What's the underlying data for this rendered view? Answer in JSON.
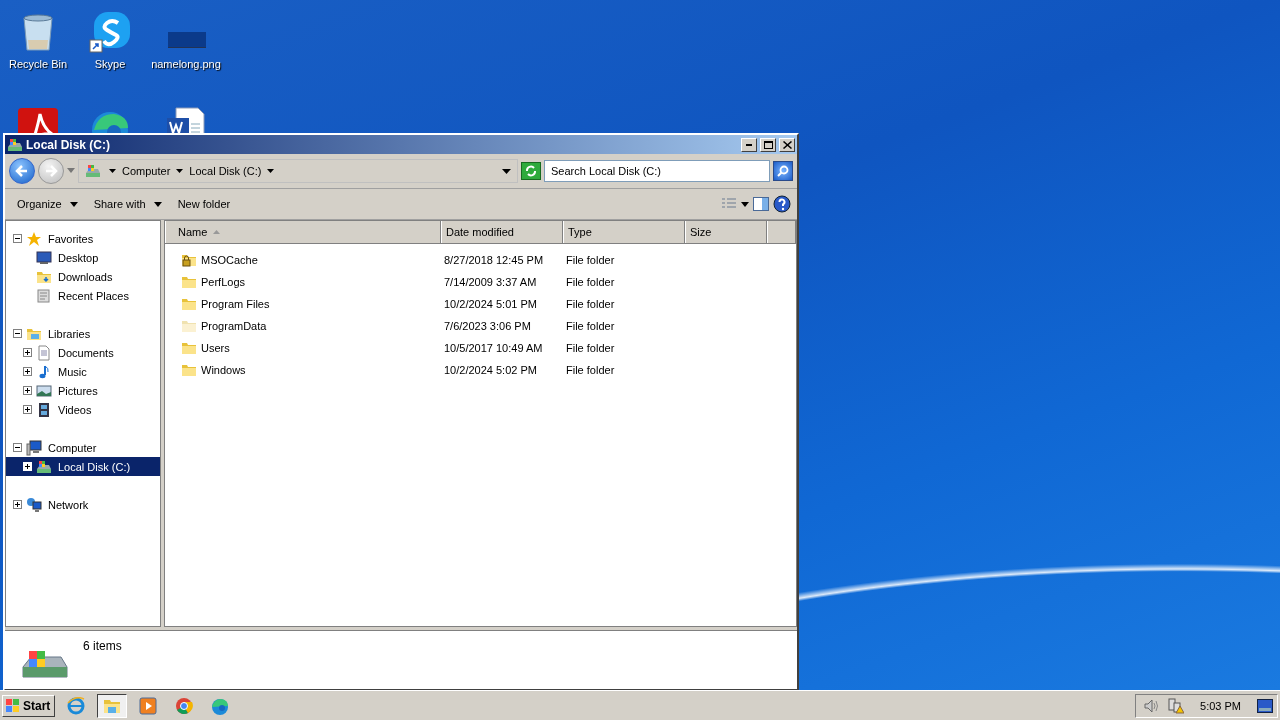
{
  "desktop": {
    "icons": [
      {
        "kind": "recycle-bin",
        "label": "Recycle Bin"
      },
      {
        "kind": "skype",
        "label": "Skype"
      },
      {
        "kind": "image",
        "label": "namelong.png"
      },
      {
        "kind": "pdf"
      },
      {
        "kind": "edge"
      },
      {
        "kind": "word"
      }
    ]
  },
  "window": {
    "title": "Local Disk (C:)",
    "address": {
      "breadcrumbs": [
        "Computer",
        "Local Disk (C:)"
      ]
    },
    "search": {
      "placeholder": "Search Local Disk (C:)"
    },
    "commands": [
      {
        "label": "Organize",
        "dropdown": true
      },
      {
        "label": "Share with",
        "dropdown": true
      },
      {
        "label": "New folder",
        "dropdown": false
      }
    ],
    "sidebar": {
      "items": [
        {
          "kind": "star",
          "label": "Favorites",
          "expanded": true,
          "selected": false,
          "children": [
            {
              "kind": "desktop",
              "label": "Desktop",
              "selected": false
            },
            {
              "kind": "downloads",
              "label": "Downloads",
              "selected": false
            },
            {
              "kind": "recent",
              "label": "Recent Places",
              "selected": false
            }
          ]
        },
        {
          "kind": "libraries",
          "label": "Libraries",
          "expanded": true,
          "selected": false,
          "children": [
            {
              "kind": "documents",
              "label": "Documents",
              "expanded": false,
              "selected": false
            },
            {
              "kind": "music",
              "label": "Music",
              "expanded": false,
              "selected": false
            },
            {
              "kind": "pictures",
              "label": "Pictures",
              "expanded": false,
              "selected": false
            },
            {
              "kind": "videos",
              "label": "Videos",
              "expanded": false,
              "selected": false
            }
          ]
        },
        {
          "kind": "computer",
          "label": "Computer",
          "expanded": true,
          "selected": false,
          "children": [
            {
              "kind": "drive",
              "label": "Local Disk (C:)",
              "expanded": false,
              "selected": true
            }
          ]
        },
        {
          "kind": "network",
          "label": "Network",
          "expanded": false,
          "selected": false
        }
      ]
    },
    "table": {
      "columns": [
        {
          "label": "Name",
          "sorted": true
        },
        {
          "label": "Date modified",
          "sorted": false
        },
        {
          "label": "Type",
          "sorted": false
        },
        {
          "label": "Size",
          "sorted": false
        }
      ],
      "rows": [
        {
          "kind": "locked",
          "name": "MSOCache",
          "date": "8/27/2018 12:45 PM",
          "type": "File folder"
        },
        {
          "kind": "folder",
          "name": "PerfLogs",
          "date": "7/14/2009 3:37 AM",
          "type": "File folder"
        },
        {
          "kind": "folder",
          "name": "Program Files",
          "date": "10/2/2024 5:01 PM",
          "type": "File folder"
        },
        {
          "kind": "hidden",
          "name": "ProgramData",
          "date": "7/6/2023 3:06 PM",
          "type": "File folder"
        },
        {
          "kind": "folder",
          "name": "Users",
          "date": "10/5/2017 10:49 AM",
          "type": "File folder"
        },
        {
          "kind": "folder",
          "name": "Windows",
          "date": "10/2/2024 5:02 PM",
          "type": "File folder"
        }
      ]
    },
    "status_bar": {
      "text": "6 items"
    }
  },
  "taskbar": {
    "start": "Start",
    "apps": [
      {
        "kind": "ie",
        "selected": false
      },
      {
        "kind": "explorer",
        "selected": true
      },
      {
        "kind": "media",
        "selected": false
      },
      {
        "kind": "chrome",
        "selected": false
      },
      {
        "kind": "edge",
        "selected": false
      }
    ],
    "clock": "5:03 PM"
  }
}
